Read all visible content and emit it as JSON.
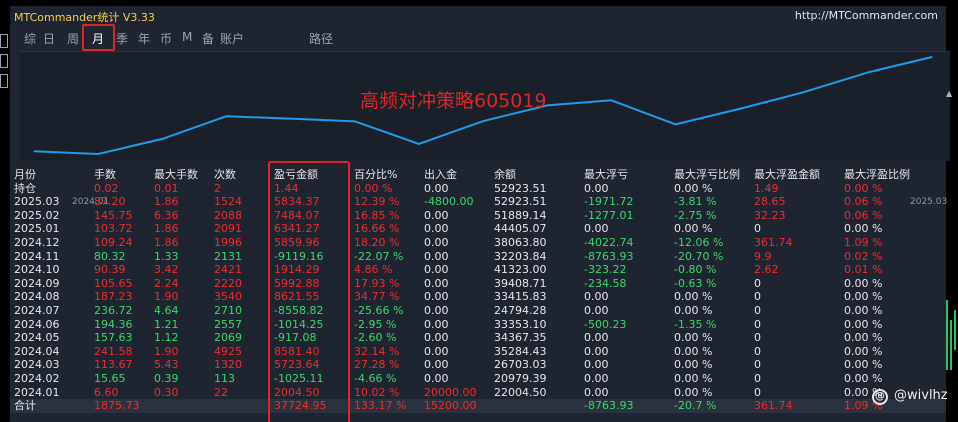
{
  "app": {
    "title": "MTCommander统计  V3.33",
    "url": "http://MTCommander.com"
  },
  "tabs": [
    {
      "label": "综",
      "active": false
    },
    {
      "label": "日",
      "active": false
    },
    {
      "label": "周",
      "active": false
    },
    {
      "label": "月",
      "active": true
    },
    {
      "label": "季",
      "active": false
    },
    {
      "label": "年",
      "active": false
    },
    {
      "label": "币",
      "active": false
    },
    {
      "label": "M",
      "active": false
    },
    {
      "label": "备",
      "active": false
    },
    {
      "label": "账户",
      "active": false
    },
    {
      "label": "路径",
      "active": false
    }
  ],
  "chart_data": {
    "type": "line",
    "title": "高频对冲策略605019",
    "xlabel": "",
    "ylabel": "",
    "x_start_label": "2024.01",
    "x_end_label": "2025.03",
    "series": [
      {
        "color": "#1e9bea",
        "x": [
          "2024.01",
          "2024.02",
          "2024.03",
          "2024.04",
          "2024.05",
          "2024.06",
          "2024.07",
          "2024.08",
          "2024.09",
          "2024.10",
          "2024.11",
          "2024.12",
          "2025.01",
          "2025.02",
          "2025.03"
        ],
        "values": [
          2004.5,
          979.39,
          6703.07,
          15284.47,
          14367.37,
          13353.12,
          4794.54,
          13416.09,
          19408.97,
          21323.26,
          12203.87,
          18063.74,
          24405.01,
          31889.31,
          37724.95
        ]
      }
    ]
  },
  "table": {
    "headers": [
      "月份",
      "手数",
      "最大手数",
      "次数",
      "盈亏金额",
      "百分比%",
      "出入金",
      "余额",
      "最大浮亏",
      "最大浮亏比例",
      "最大浮盈金额",
      "最大浮盈比例"
    ],
    "holding": {
      "label": "持仓",
      "cells": [
        {
          "text": "0.02",
          "color": "red"
        },
        {
          "text": "0.01",
          "color": "red"
        },
        {
          "text": "2",
          "color": "red"
        },
        {
          "text": "1.44",
          "color": "red"
        },
        {
          "text": "0.00 %",
          "color": "red"
        },
        {
          "text": "0.00",
          "color": "white"
        },
        {
          "text": "52923.51",
          "color": "white"
        },
        {
          "text": "0.00",
          "color": "white"
        },
        {
          "text": "0.00 %",
          "color": "white"
        },
        {
          "text": "1.49",
          "color": "red"
        },
        {
          "text": "0.00 %",
          "color": "red"
        }
      ]
    },
    "rows": [
      {
        "month": "2025.03",
        "cells": [
          {
            "text": "87.20",
            "color": "red"
          },
          {
            "text": "1.86",
            "color": "red"
          },
          {
            "text": "1524",
            "color": "red"
          },
          {
            "text": "5834.37",
            "color": "red"
          },
          {
            "text": "12.39 %",
            "color": "red"
          },
          {
            "text": "-4800.00",
            "color": "green"
          },
          {
            "text": "52923.51",
            "color": "white"
          },
          {
            "text": "-1971.72",
            "color": "green"
          },
          {
            "text": "-3.81 %",
            "color": "green"
          },
          {
            "text": "28.65",
            "color": "red"
          },
          {
            "text": "0.06 %",
            "color": "red"
          }
        ]
      },
      {
        "month": "2025.02",
        "cells": [
          {
            "text": "145.75",
            "color": "red"
          },
          {
            "text": "6.36",
            "color": "red"
          },
          {
            "text": "2088",
            "color": "red"
          },
          {
            "text": "7484.07",
            "color": "red"
          },
          {
            "text": "16.85 %",
            "color": "red"
          },
          {
            "text": "0.00",
            "color": "white"
          },
          {
            "text": "51889.14",
            "color": "white"
          },
          {
            "text": "-1277.01",
            "color": "green"
          },
          {
            "text": "-2.75 %",
            "color": "green"
          },
          {
            "text": "32.23",
            "color": "red"
          },
          {
            "text": "0.06 %",
            "color": "red"
          }
        ]
      },
      {
        "month": "2025.01",
        "cells": [
          {
            "text": "103.72",
            "color": "red"
          },
          {
            "text": "1.86",
            "color": "red"
          },
          {
            "text": "2091",
            "color": "red"
          },
          {
            "text": "6341.27",
            "color": "red"
          },
          {
            "text": "16.66 %",
            "color": "red"
          },
          {
            "text": "0.00",
            "color": "white"
          },
          {
            "text": "44405.07",
            "color": "white"
          },
          {
            "text": "0.00",
            "color": "white"
          },
          {
            "text": "0.00 %",
            "color": "white"
          },
          {
            "text": "0",
            "color": "white"
          },
          {
            "text": "0.00 %",
            "color": "white"
          }
        ]
      },
      {
        "month": "2024.12",
        "cells": [
          {
            "text": "109.24",
            "color": "red"
          },
          {
            "text": "1.86",
            "color": "red"
          },
          {
            "text": "1996",
            "color": "red"
          },
          {
            "text": "5859.96",
            "color": "red"
          },
          {
            "text": "18.20 %",
            "color": "red"
          },
          {
            "text": "0.00",
            "color": "white"
          },
          {
            "text": "38063.80",
            "color": "white"
          },
          {
            "text": "-4022.74",
            "color": "green"
          },
          {
            "text": "-12.06 %",
            "color": "green"
          },
          {
            "text": "361.74",
            "color": "red"
          },
          {
            "text": "1.09 %",
            "color": "red"
          }
        ]
      },
      {
        "month": "2024.11",
        "cells": [
          {
            "text": "80.32",
            "color": "green"
          },
          {
            "text": "1.33",
            "color": "green"
          },
          {
            "text": "2131",
            "color": "green"
          },
          {
            "text": "-9119.16",
            "color": "green"
          },
          {
            "text": "-22.07 %",
            "color": "green"
          },
          {
            "text": "0.00",
            "color": "white"
          },
          {
            "text": "32203.84",
            "color": "white"
          },
          {
            "text": "-8763.93",
            "color": "green"
          },
          {
            "text": "-20.70 %",
            "color": "green"
          },
          {
            "text": "9.9",
            "color": "red"
          },
          {
            "text": "0.02 %",
            "color": "red"
          }
        ]
      },
      {
        "month": "2024.10",
        "cells": [
          {
            "text": "90.39",
            "color": "red"
          },
          {
            "text": "3.42",
            "color": "red"
          },
          {
            "text": "2421",
            "color": "red"
          },
          {
            "text": "1914.29",
            "color": "red"
          },
          {
            "text": "4.86 %",
            "color": "red"
          },
          {
            "text": "0.00",
            "color": "white"
          },
          {
            "text": "41323.00",
            "color": "white"
          },
          {
            "text": "-323.22",
            "color": "green"
          },
          {
            "text": "-0.80 %",
            "color": "green"
          },
          {
            "text": "2.62",
            "color": "red"
          },
          {
            "text": "0.01 %",
            "color": "red"
          }
        ]
      },
      {
        "month": "2024.09",
        "cells": [
          {
            "text": "105.65",
            "color": "red"
          },
          {
            "text": "2.24",
            "color": "red"
          },
          {
            "text": "2220",
            "color": "red"
          },
          {
            "text": "5992.88",
            "color": "red"
          },
          {
            "text": "17.93 %",
            "color": "red"
          },
          {
            "text": "0.00",
            "color": "white"
          },
          {
            "text": "39408.71",
            "color": "white"
          },
          {
            "text": "-234.58",
            "color": "green"
          },
          {
            "text": "-0.63 %",
            "color": "green"
          },
          {
            "text": "0",
            "color": "white"
          },
          {
            "text": "0.00 %",
            "color": "white"
          }
        ]
      },
      {
        "month": "2024.08",
        "cells": [
          {
            "text": "187.23",
            "color": "red"
          },
          {
            "text": "1.90",
            "color": "red"
          },
          {
            "text": "3540",
            "color": "red"
          },
          {
            "text": "8621.55",
            "color": "red"
          },
          {
            "text": "34.77 %",
            "color": "red"
          },
          {
            "text": "0.00",
            "color": "white"
          },
          {
            "text": "33415.83",
            "color": "white"
          },
          {
            "text": "0.00",
            "color": "white"
          },
          {
            "text": "0.00 %",
            "color": "white"
          },
          {
            "text": "0",
            "color": "white"
          },
          {
            "text": "0.00 %",
            "color": "white"
          }
        ]
      },
      {
        "month": "2024.07",
        "cells": [
          {
            "text": "236.72",
            "color": "green"
          },
          {
            "text": "4.64",
            "color": "green"
          },
          {
            "text": "2710",
            "color": "green"
          },
          {
            "text": "-8558.82",
            "color": "green"
          },
          {
            "text": "-25.66 %",
            "color": "green"
          },
          {
            "text": "0.00",
            "color": "white"
          },
          {
            "text": "24794.28",
            "color": "white"
          },
          {
            "text": "0.00",
            "color": "white"
          },
          {
            "text": "0.00 %",
            "color": "white"
          },
          {
            "text": "0",
            "color": "white"
          },
          {
            "text": "0.00 %",
            "color": "white"
          }
        ]
      },
      {
        "month": "2024.06",
        "cells": [
          {
            "text": "194.36",
            "color": "green"
          },
          {
            "text": "1.21",
            "color": "green"
          },
          {
            "text": "2557",
            "color": "green"
          },
          {
            "text": "-1014.25",
            "color": "green"
          },
          {
            "text": "-2.95 %",
            "color": "green"
          },
          {
            "text": "0.00",
            "color": "white"
          },
          {
            "text": "33353.10",
            "color": "white"
          },
          {
            "text": "-500.23",
            "color": "green"
          },
          {
            "text": "-1.35 %",
            "color": "green"
          },
          {
            "text": "0",
            "color": "white"
          },
          {
            "text": "0.00 %",
            "color": "white"
          }
        ]
      },
      {
        "month": "2024.05",
        "cells": [
          {
            "text": "157.63",
            "color": "green"
          },
          {
            "text": "1.12",
            "color": "green"
          },
          {
            "text": "2069",
            "color": "green"
          },
          {
            "text": "-917.08",
            "color": "green"
          },
          {
            "text": "-2.60 %",
            "color": "green"
          },
          {
            "text": "0.00",
            "color": "white"
          },
          {
            "text": "34367.35",
            "color": "white"
          },
          {
            "text": "0.00",
            "color": "white"
          },
          {
            "text": "0.00 %",
            "color": "white"
          },
          {
            "text": "0",
            "color": "white"
          },
          {
            "text": "0.00 %",
            "color": "white"
          }
        ]
      },
      {
        "month": "2024.04",
        "cells": [
          {
            "text": "241.58",
            "color": "red"
          },
          {
            "text": "1.90",
            "color": "red"
          },
          {
            "text": "4925",
            "color": "red"
          },
          {
            "text": "8581.40",
            "color": "red"
          },
          {
            "text": "32.14 %",
            "color": "red"
          },
          {
            "text": "0.00",
            "color": "white"
          },
          {
            "text": "35284.43",
            "color": "white"
          },
          {
            "text": "0.00",
            "color": "white"
          },
          {
            "text": "0.00 %",
            "color": "white"
          },
          {
            "text": "0",
            "color": "white"
          },
          {
            "text": "0.00 %",
            "color": "white"
          }
        ]
      },
      {
        "month": "2024.03",
        "cells": [
          {
            "text": "113.67",
            "color": "red"
          },
          {
            "text": "5.43",
            "color": "red"
          },
          {
            "text": "1320",
            "color": "red"
          },
          {
            "text": "5723.64",
            "color": "red"
          },
          {
            "text": "27.28 %",
            "color": "red"
          },
          {
            "text": "0.00",
            "color": "white"
          },
          {
            "text": "26703.03",
            "color": "white"
          },
          {
            "text": "0.00",
            "color": "white"
          },
          {
            "text": "0.00 %",
            "color": "white"
          },
          {
            "text": "0",
            "color": "white"
          },
          {
            "text": "0.00 %",
            "color": "white"
          }
        ]
      },
      {
        "month": "2024.02",
        "cells": [
          {
            "text": "15.65",
            "color": "green"
          },
          {
            "text": "0.39",
            "color": "green"
          },
          {
            "text": "113",
            "color": "green"
          },
          {
            "text": "-1025.11",
            "color": "green"
          },
          {
            "text": "-4.66 %",
            "color": "green"
          },
          {
            "text": "0.00",
            "color": "white"
          },
          {
            "text": "20979.39",
            "color": "white"
          },
          {
            "text": "0.00",
            "color": "white"
          },
          {
            "text": "0.00 %",
            "color": "white"
          },
          {
            "text": "0",
            "color": "white"
          },
          {
            "text": "0.00 %",
            "color": "white"
          }
        ]
      },
      {
        "month": "2024.01",
        "cells": [
          {
            "text": "6.60",
            "color": "red"
          },
          {
            "text": "0.30",
            "color": "red"
          },
          {
            "text": "22",
            "color": "red"
          },
          {
            "text": "2004.50",
            "color": "red"
          },
          {
            "text": "10.02 %",
            "color": "red"
          },
          {
            "text": "20000.00",
            "color": "red"
          },
          {
            "text": "22004.50",
            "color": "white"
          },
          {
            "text": "0.00",
            "color": "white"
          },
          {
            "text": "0.00 %",
            "color": "white"
          },
          {
            "text": "0",
            "color": "white"
          },
          {
            "text": "0.00 %",
            "color": "white"
          }
        ]
      }
    ],
    "total": {
      "label": "合计",
      "cells": [
        {
          "text": "1875.73",
          "color": "red"
        },
        {
          "text": "",
          "color": "white"
        },
        {
          "text": "",
          "color": "white"
        },
        {
          "text": "37724.95",
          "color": "red"
        },
        {
          "text": "133.17 %",
          "color": "red"
        },
        {
          "text": "15200.00",
          "color": "red"
        },
        {
          "text": "",
          "color": "white"
        },
        {
          "text": "-8763.93",
          "color": "green"
        },
        {
          "text": "-20.7 %",
          "color": "green"
        },
        {
          "text": "361.74",
          "color": "red"
        },
        {
          "text": "1.09 %",
          "color": "red"
        }
      ]
    }
  },
  "watermark": {
    "icon": "@",
    "text": "@wivlhz"
  },
  "colors": {
    "red": "#ef2c2c",
    "green": "#38d96a",
    "line": "#1e9bea",
    "highlight": "#e02424"
  }
}
